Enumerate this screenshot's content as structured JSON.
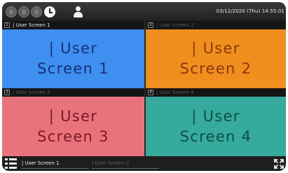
{
  "topbar": {
    "controls": [
      {
        "icon": "window-control-icon",
        "state": "inactive"
      },
      {
        "icon": "window-control-icon",
        "state": "inactive"
      },
      {
        "icon": "window-control-icon",
        "state": "inactive"
      },
      {
        "icon": "clock-icon",
        "state": "active"
      }
    ],
    "user_icon": "user-icon",
    "datetime": "03/12/2020 (Thu) 14:55:01"
  },
  "screens": [
    {
      "number": "1",
      "header_title": "| User Screen 1",
      "header_active": true,
      "label": "| User\nScreen 1",
      "color": "#3e8ff0"
    },
    {
      "number": "2",
      "header_title": "| User Screen 2",
      "header_active": false,
      "label": "| User\nScreen 2",
      "color": "#f08e1e"
    },
    {
      "number": "3",
      "header_title": "| User Screen 3",
      "header_active": false,
      "label": "| User\nScreen 3",
      "color": "#e9737c"
    },
    {
      "number": "4",
      "header_title": "| User Screen 4",
      "header_active": false,
      "label": "| User\nScreen 4",
      "color": "#36aa9c"
    }
  ],
  "bottombar": {
    "menu_icon": "menu-list-icon",
    "tabs": [
      {
        "label": "| User Screen 1",
        "active": true
      },
      {
        "label": "| User Screen 2",
        "active": false
      }
    ],
    "expand_icon": "fullscreen-icon"
  }
}
